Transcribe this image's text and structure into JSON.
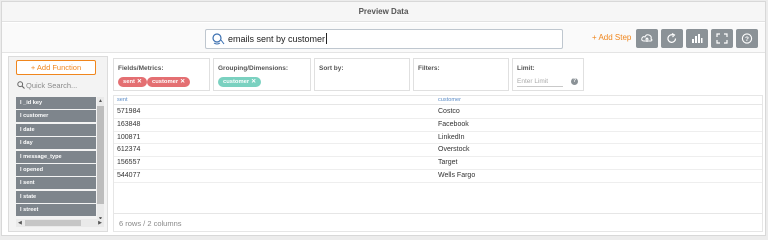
{
  "window": {
    "title": "Preview Data"
  },
  "toolbar": {
    "query_text": "emails sent by customer",
    "add_step_label": "+ Add Step",
    "buttons": [
      "cloud-upload-icon",
      "refresh-icon",
      "chart-icon",
      "expand-icon",
      "help-icon"
    ]
  },
  "sidebar": {
    "add_function_label": "+ Add Function",
    "search_placeholder": "Quick Search...",
    "fields": [
      {
        "label": "I _id key"
      },
      {
        "label": "I customer"
      },
      {
        "label": "I date"
      },
      {
        "label": "I day"
      },
      {
        "label": "I message_type"
      },
      {
        "label": "I opened"
      },
      {
        "label": "I sent"
      },
      {
        "label": "I state"
      },
      {
        "label": "I street"
      }
    ]
  },
  "filters": {
    "fields_metrics": {
      "label": "Fields/Metrics:",
      "chips": [
        "sent",
        "customer"
      ]
    },
    "grouping": {
      "label": "Grouping/Dimensions:",
      "chips": [
        "customer"
      ]
    },
    "sort_by": {
      "label": "Sort by:"
    },
    "filters": {
      "label": "Filters:"
    },
    "limit": {
      "label": "Limit:",
      "placeholder": "Enter Limit",
      "help": "?"
    }
  },
  "grid": {
    "columns": [
      "sent",
      "customer"
    ],
    "rows": [
      [
        "571984",
        "Costco"
      ],
      [
        "163848",
        "Facebook"
      ],
      [
        "100871",
        "LinkedIn"
      ],
      [
        "612374",
        "Overstock"
      ],
      [
        "156557",
        "Target"
      ],
      [
        "544077",
        "Wells Fargo"
      ]
    ],
    "footer": "6 rows / 2 columns"
  },
  "colors": {
    "accent": "#f0861d",
    "chip_red": "#e46f72",
    "chip_teal": "#7ad1c0",
    "button_gray": "#8b9297",
    "header_blue": "#5b8cc7"
  }
}
